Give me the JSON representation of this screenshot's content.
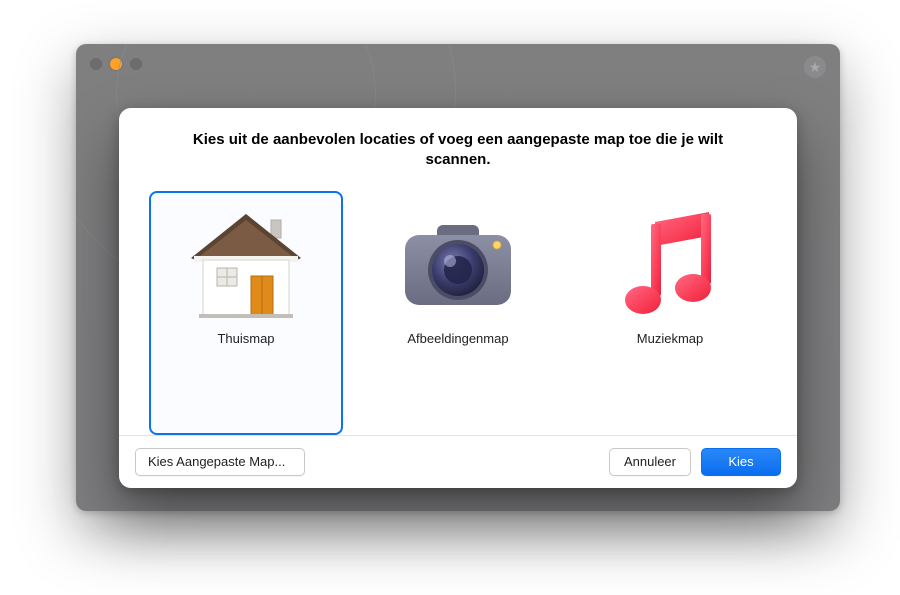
{
  "dialog": {
    "title": "Kies uit de aanbevolen locaties of voeg een aangepaste map toe die je wilt scannen.",
    "options": [
      {
        "label": "Thuismap",
        "icon": "home-folder-icon",
        "selected": true
      },
      {
        "label": "Afbeeldingenmap",
        "icon": "pictures-folder-icon",
        "selected": false
      },
      {
        "label": "Muziekmap",
        "icon": "music-folder-icon",
        "selected": false
      }
    ],
    "custom_button": "Kies Aangepaste Map...",
    "cancel_button": "Annuleer",
    "choose_button": "Kies"
  },
  "colors": {
    "accent": "#0a74f0",
    "primary_button": "#0a6ef0"
  }
}
